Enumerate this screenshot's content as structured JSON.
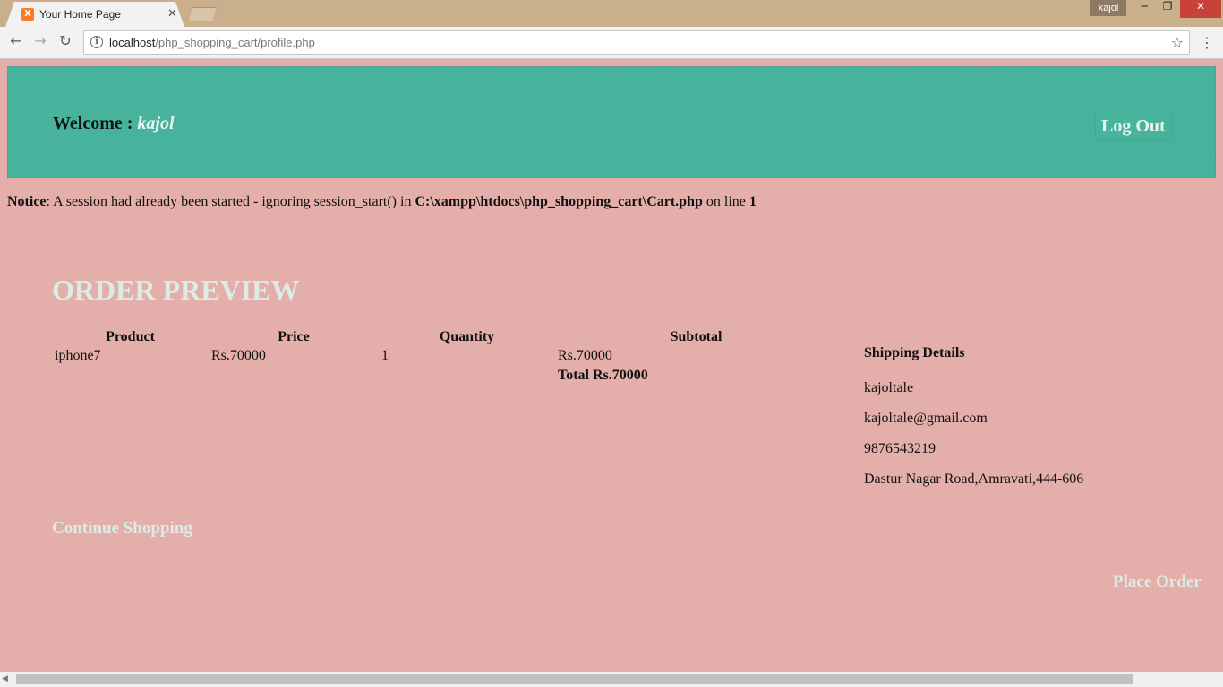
{
  "browser": {
    "tab_title": "Your Home Page",
    "tab_favicon": "xampp-icon",
    "profile_name": "kajol",
    "url_host": "localhost",
    "url_path": "/php_shopping_cart/profile.php"
  },
  "header": {
    "welcome_label": "Welcome :",
    "username": "kajol",
    "logout_label": "Log Out"
  },
  "notice": {
    "label": "Notice",
    "text_before": ": A session had already been started - ignoring session_start() in ",
    "path": "C:\\xampp\\htdocs\\php_shopping_cart\\Cart.php",
    "text_after": " on line ",
    "line": "1"
  },
  "order": {
    "title": "ORDER PREVIEW",
    "columns": [
      "Product",
      "Price",
      "Quantity",
      "Subtotal"
    ],
    "rows": [
      {
        "product": "iphone7",
        "price": "Rs.70000",
        "quantity": "1",
        "subtotal": "Rs.70000"
      }
    ],
    "total": "Total Rs.70000"
  },
  "shipping": {
    "heading": "Shipping Details",
    "name": "kajoltale",
    "email": "kajoltale@gmail.com",
    "phone": "9876543219",
    "address": "Dastur Nagar Road,Amravati,444-606"
  },
  "actions": {
    "continue_label": "Continue Shopping",
    "place_order_label": "Place Order"
  },
  "colors": {
    "page_bg": "#e4aeaa",
    "header_bg": "#47b39d",
    "accent_text": "#dbece5"
  }
}
